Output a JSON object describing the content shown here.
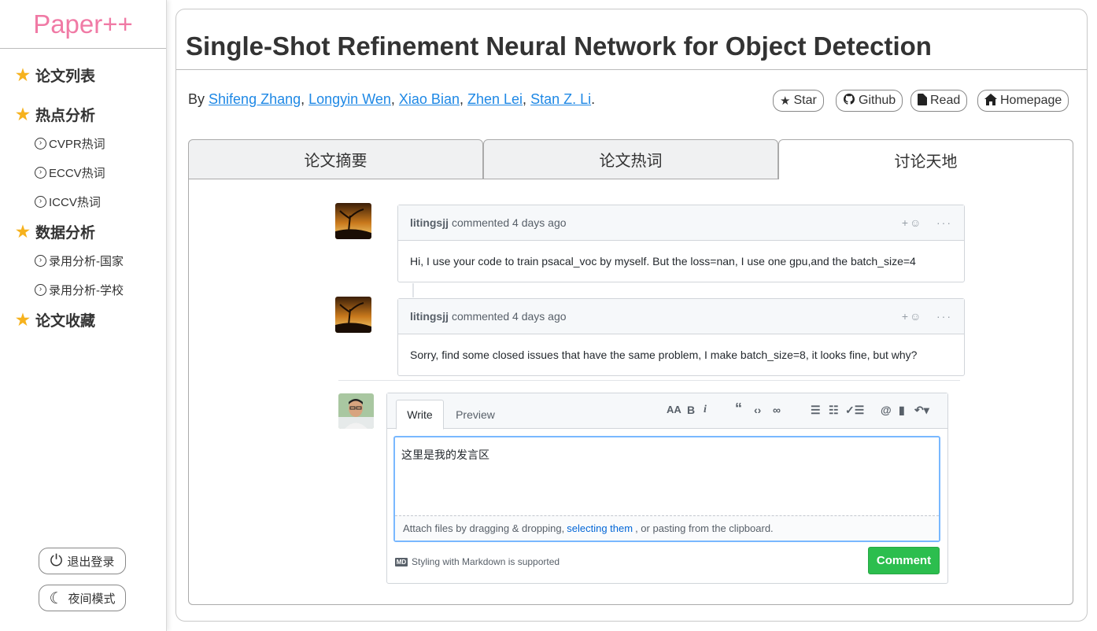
{
  "sidebar": {
    "logo": "Paper++",
    "sections": [
      {
        "label": "论文列表"
      },
      {
        "label": "热点分析"
      },
      {
        "label": "数据分析"
      },
      {
        "label": "论文收藏"
      }
    ],
    "hot_items": [
      {
        "label": "CVPR热词"
      },
      {
        "label": "ECCV热词"
      },
      {
        "label": "ICCV热词"
      }
    ],
    "data_items": [
      {
        "label": "录用分析-国家"
      },
      {
        "label": "录用分析-学校"
      }
    ],
    "logout_label": "退出登录",
    "night_mode_label": "夜间模式"
  },
  "paper": {
    "title": "Single-Shot Refinement Neural Network for Object Detection",
    "by_label": "By",
    "authors": [
      "Shifeng Zhang",
      "Longyin Wen",
      "Xiao Bian",
      "Zhen Lei",
      "Stan Z. Li"
    ],
    "actions": {
      "star": "Star",
      "github": "Github",
      "read": "Read",
      "homepage": "Homepage"
    }
  },
  "tabs": [
    {
      "label": "论文摘要"
    },
    {
      "label": "论文热词"
    },
    {
      "label": "讨论天地"
    }
  ],
  "comments": [
    {
      "author": "litingsjj",
      "meta": "commented 4 days ago",
      "body": "Hi, I use your code to train psacal_voc by myself. But the loss=nan, I use one gpu,and the batch_size=4"
    },
    {
      "author": "litingsjj",
      "meta": "commented 4 days ago",
      "body": "Sorry, find some closed issues that have the same problem, I make batch_size=8, it looks fine, but why?"
    }
  ],
  "editor": {
    "tab_write": "Write",
    "tab_preview": "Preview",
    "text": "这里是我的发言区",
    "attach_prefix": "Attach files by dragging & dropping,",
    "attach_link": "selecting them",
    "attach_suffix": ", or pasting from the clipboard.",
    "markdown_note": "Styling with Markdown is supported",
    "markdown_icon": "MD",
    "submit_label": "Comment"
  },
  "colors": {
    "logo": "#f07aa5",
    "link": "#1e88e5",
    "submit": "#2cbe4e",
    "star": "#f6b21e"
  }
}
